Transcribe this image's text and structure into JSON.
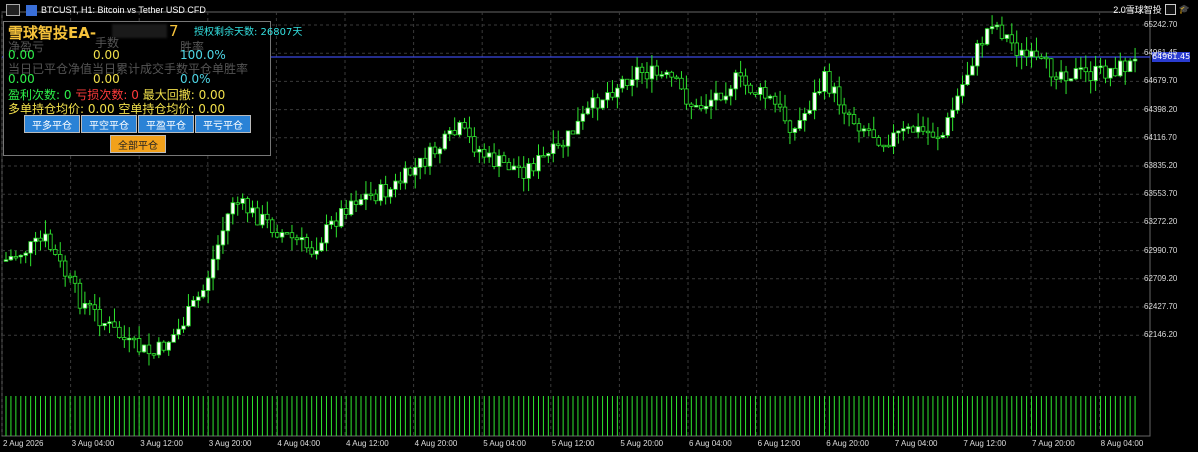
{
  "window": {
    "title": "BTCUST, H1:  Bitcoin vs Tether USD CFD",
    "ea_tag": "2.0雪球智投"
  },
  "ea": {
    "title": "雪球智投EA-",
    "title_suffix": "7",
    "license": "授权剩余天数: 26807天",
    "headers": {
      "net_profit": "净盈亏",
      "lots": "手数",
      "win_rate": "胜率"
    },
    "row1": {
      "net_profit": "0.00",
      "lots": "0.00",
      "win_rate": "100.0%"
    },
    "day_header": "当日已平仓净值当日累计成交手数平仓单胜率",
    "row2": {
      "net_profit": "0.00",
      "lots": "0.00",
      "win_rate": "0.0%"
    },
    "stats": {
      "win_label": "盈利次数:",
      "win_value": "0",
      "loss_label": "亏损次数:",
      "loss_value": "0",
      "dd_label": "最大回撤:",
      "dd_value": "0.00"
    },
    "avg": {
      "long_label": "多单持仓均价:",
      "long_value": "0.00",
      "short_label": "空单持仓均价:",
      "short_value": "0.00"
    },
    "buttons": [
      "平多平仓",
      "平空平仓",
      "平盈平仓",
      "平亏平仓"
    ],
    "close_all": "全部平仓"
  },
  "price_axis": [
    "65242.70",
    "64961.45",
    "64679.70",
    "64398.20",
    "64116.70",
    "63835.20",
    "63553.70",
    "63272.20",
    "62990.70",
    "62709.20",
    "62427.70",
    "62146.20"
  ],
  "current_price_label": "64961.45",
  "time_axis": [
    "2 Aug 2026",
    "3 Aug 04:00",
    "3 Aug 12:00",
    "3 Aug 20:00",
    "4 Aug 04:00",
    "4 Aug 12:00",
    "4 Aug 20:00",
    "5 Aug 04:00",
    "5 Aug 12:00",
    "5 Aug 20:00",
    "6 Aug 04:00",
    "6 Aug 12:00",
    "6 Aug 20:00",
    "7 Aug 04:00",
    "7 Aug 12:00",
    "7 Aug 20:00",
    "8 Aug 04:00"
  ],
  "colors": {
    "bull": "#ffffff",
    "bear": "#000000",
    "wick": "#2ee62e",
    "grid": "#3a3a3a",
    "bid_line": "#3b48e0"
  }
}
